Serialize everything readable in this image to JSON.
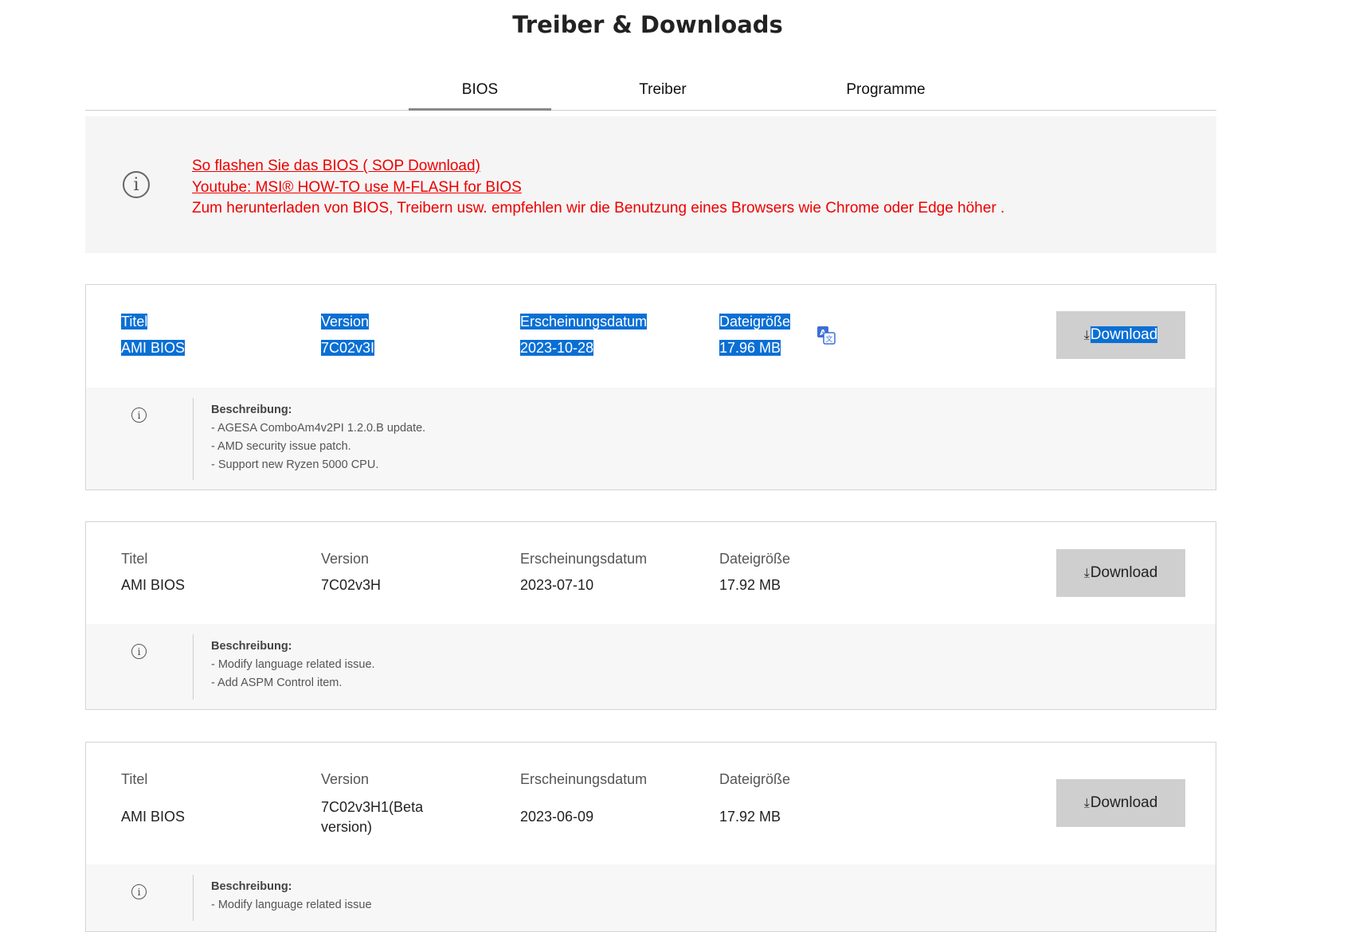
{
  "page_title": "Treiber & Downloads",
  "tabs": [
    {
      "label": "BIOS",
      "active": true
    },
    {
      "label": "Treiber",
      "active": false
    },
    {
      "label": "Programme",
      "active": false
    }
  ],
  "notice": {
    "icon": "info-icon",
    "link1": "So flashen Sie das BIOS ( SOP Download)",
    "link2": "Youtube: MSI® HOW-TO use M-FLASH for BIOS",
    "text": "Zum herunterladen von BIOS, Treibern usw. empfehlen wir die Benutzung eines Browsers wie Chrome oder Edge höher ."
  },
  "labels": {
    "title": "Titel",
    "version": "Version",
    "date": "Erscheinungsdatum",
    "size": "Dateigröße",
    "download": "Download",
    "description": "Beschreibung:"
  },
  "items": [
    {
      "title": "AMI BIOS",
      "version": "7C02v3I",
      "date": "2023-10-28",
      "size": "17.96 MB",
      "selected": true,
      "description": [
        "- AGESA ComboAm4v2PI 1.2.0.B update.",
        "- AMD security issue patch.",
        "- Support new Ryzen 5000 CPU."
      ]
    },
    {
      "title": "AMI BIOS",
      "version": "7C02v3H",
      "date": "2023-07-10",
      "size": "17.92 MB",
      "selected": false,
      "description": [
        "- Modify language related issue.",
        "- Add ASPM Control item."
      ]
    },
    {
      "title": "AMI BIOS",
      "version": "7C02v3H1(Beta version)",
      "date": "2023-06-09",
      "size": "17.92 MB",
      "selected": false,
      "description": [
        "- Modify language related issue"
      ]
    }
  ],
  "colors": {
    "notice_red": "#ee0000",
    "selection_blue": "#0a6fd4",
    "button_gray": "#cfcfcf"
  }
}
